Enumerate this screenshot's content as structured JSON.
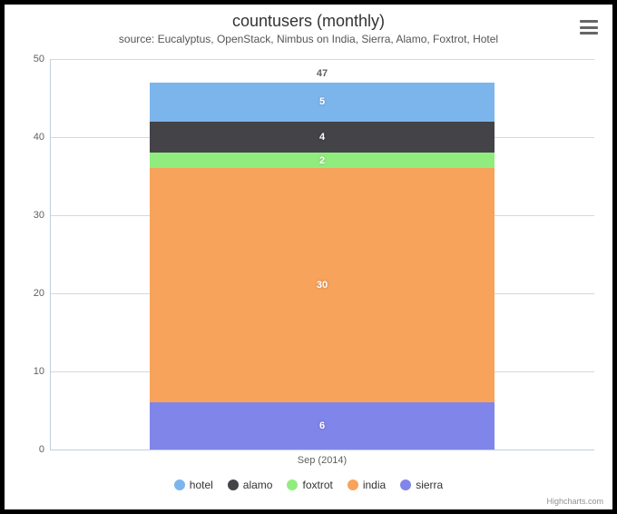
{
  "title": "countusers (monthly)",
  "subtitle": "source: Eucalyptus, OpenStack, Nimbus on India, Sierra, Alamo, Foxtrot, Hotel",
  "x_label": "Sep (2014)",
  "y_ticks": [
    "0",
    "10",
    "20",
    "30",
    "40",
    "50"
  ],
  "total_label": "47",
  "series": [
    {
      "name": "hotel",
      "color": "#7cb5ec",
      "value": 5,
      "label": "5"
    },
    {
      "name": "alamo",
      "color": "#434348",
      "value": 4,
      "label": "4"
    },
    {
      "name": "foxtrot",
      "color": "#90ed7d",
      "value": 2,
      "label": "2"
    },
    {
      "name": "india",
      "color": "#f7a35c",
      "value": 30,
      "label": "30"
    },
    {
      "name": "sierra",
      "color": "#8085e9",
      "value": 6,
      "label": "6"
    }
  ],
  "credit": "Highcharts.com",
  "y_max": 50,
  "chart_data": {
    "type": "bar",
    "stacked": true,
    "categories": [
      "Sep (2014)"
    ],
    "series": [
      {
        "name": "hotel",
        "values": [
          5
        ]
      },
      {
        "name": "alamo",
        "values": [
          4
        ]
      },
      {
        "name": "foxtrot",
        "values": [
          2
        ]
      },
      {
        "name": "india",
        "values": [
          30
        ]
      },
      {
        "name": "sierra",
        "values": [
          6
        ]
      }
    ],
    "title": "countusers (monthly)",
    "subtitle": "source: Eucalyptus, OpenStack, Nimbus on India, Sierra, Alamo, Foxtrot, Hotel",
    "xlabel": "",
    "ylabel": "",
    "ylim": [
      0,
      50
    ],
    "total": 47,
    "legend_position": "bottom"
  }
}
